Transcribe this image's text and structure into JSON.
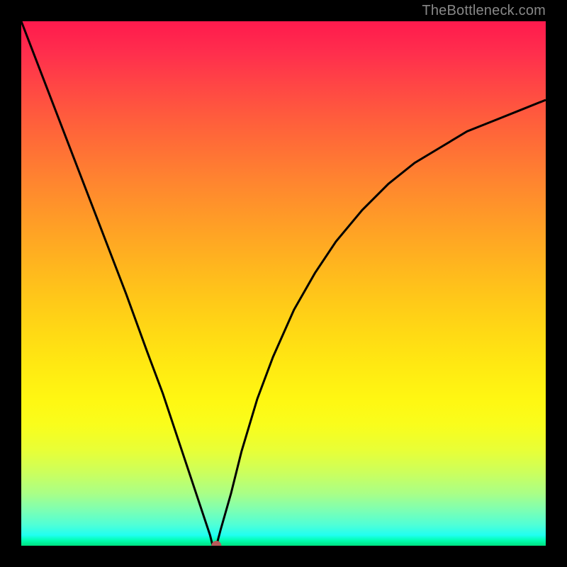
{
  "watermark": "TheBottleneck.com",
  "chart_data": {
    "type": "line",
    "title": "",
    "xlabel": "",
    "ylabel": "",
    "xlim": [
      0,
      100
    ],
    "ylim": [
      0,
      100
    ],
    "grid": false,
    "legend": false,
    "gradient_colors": {
      "top": "#ff1a4d",
      "mid": "#ffdb14",
      "bottom": "#00e080"
    },
    "series": [
      {
        "name": "bottleneck-curve",
        "color": "#000000",
        "x": [
          0,
          5,
          10,
          15,
          20,
          24,
          27,
          30,
          32,
          34,
          35,
          36,
          36.5,
          37.2,
          38,
          40,
          42,
          45,
          48,
          52,
          56,
          60,
          65,
          70,
          75,
          80,
          85,
          90,
          95,
          100
        ],
        "y": [
          100,
          87,
          74,
          61,
          48,
          37,
          29,
          20,
          14,
          8,
          5,
          2,
          0,
          0,
          3,
          10,
          18,
          28,
          36,
          45,
          52,
          58,
          64,
          69,
          73,
          76,
          79,
          81,
          83,
          85
        ]
      }
    ],
    "marker": {
      "name": "optimal-point",
      "x": 37.2,
      "y": 0,
      "color": "#b85a5a",
      "radius_px": 7
    }
  }
}
